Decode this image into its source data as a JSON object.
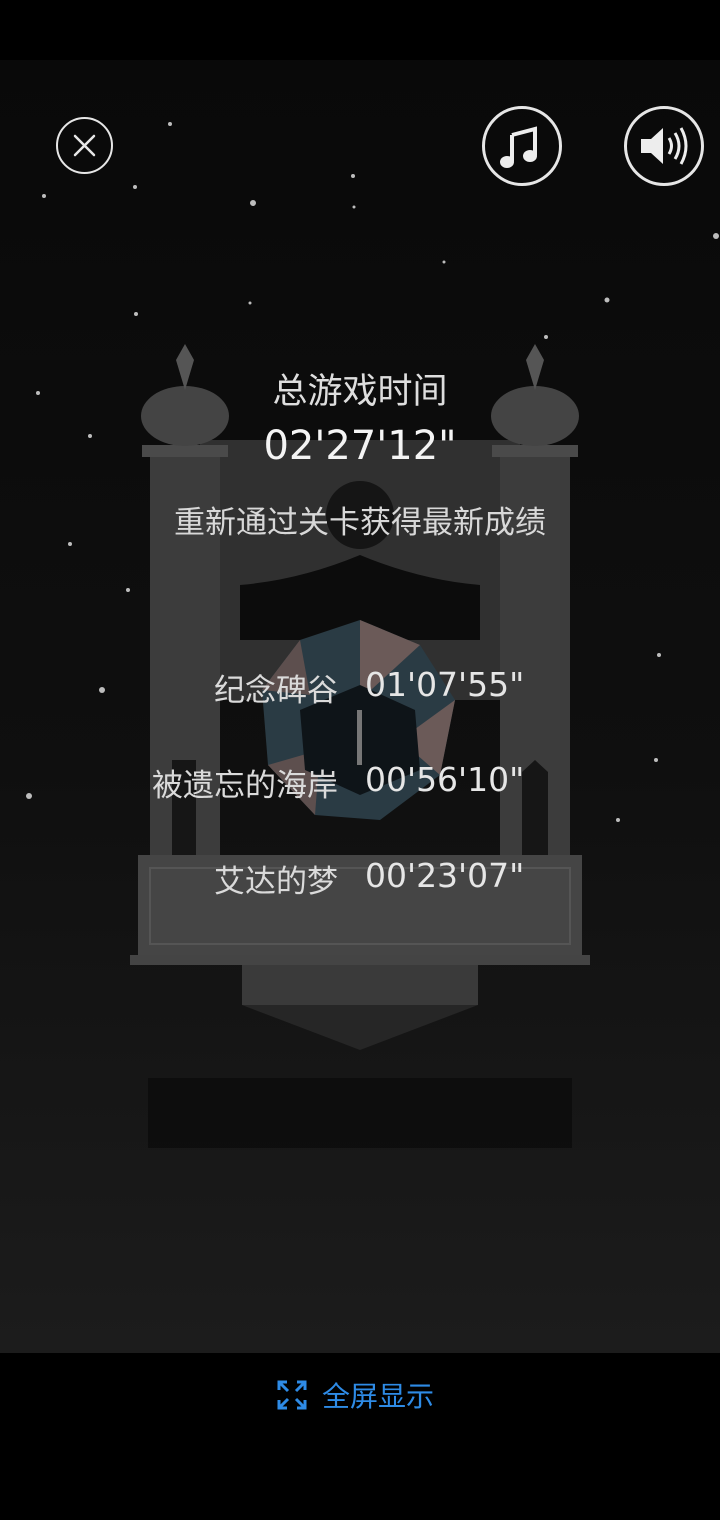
{
  "game": {
    "total_label": "总游戏时间",
    "total_time": "02'27'12\"",
    "hint": "重新通过关卡获得最新成绩",
    "levels": [
      {
        "name": "纪念碑谷",
        "time": "01'07'55\""
      },
      {
        "name": "被遗忘的海岸",
        "time": "00'56'10\""
      },
      {
        "name": "艾达的梦",
        "time": "00'23'07\""
      }
    ],
    "controls": {
      "close_icon": "close-icon",
      "music_icon": "music-note-icon",
      "sound_icon": "speaker-icon"
    }
  },
  "bottom_bar": {
    "fullscreen_label": "全屏显示",
    "fullscreen_icon": "expand-icon",
    "accent": "#2e8be6"
  }
}
